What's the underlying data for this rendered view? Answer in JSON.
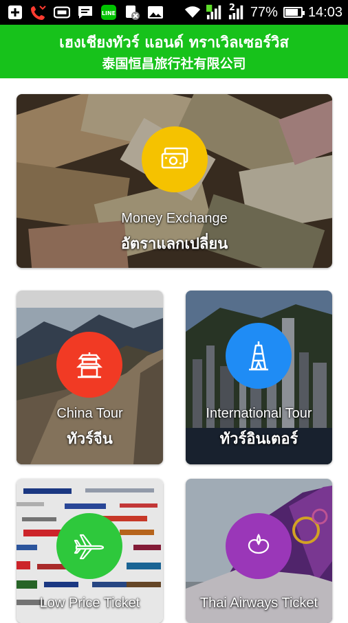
{
  "status_bar": {
    "battery_percent": "77%",
    "time": "14:03",
    "sim2_label": "2",
    "icons": [
      "plus-icon",
      "missed-call-icon",
      "tablet-icon",
      "message-icon",
      "line-app-icon",
      "app-notification-icon",
      "image-icon",
      "wifi-icon",
      "signal-icon"
    ]
  },
  "header": {
    "title_thai": "เฮงเชียงทัวร์ แอนด์ ทราเวิลเซอร์วิส",
    "title_chinese": "泰国恒昌旅行社有限公司",
    "color": "#17c21b"
  },
  "tiles": [
    {
      "id": "money",
      "en": "Money Exchange",
      "th": "อัตราแลกเปลี่ยน",
      "icon": "money-bills-icon",
      "circle_color": "#f5c200"
    },
    {
      "id": "china",
      "en": "China Tour",
      "th": "ทัวร์จีน",
      "icon": "pagoda-icon",
      "circle_color": "#f13a24"
    },
    {
      "id": "intl",
      "en": "International Tour",
      "th": "ทัวร์อินเตอร์",
      "icon": "eiffel-tower-icon",
      "circle_color": "#1f8cf5"
    },
    {
      "id": "low",
      "en": "Low Price Ticket",
      "th": "",
      "icon": "airplane-icon",
      "circle_color": "#2ec83c"
    },
    {
      "id": "thai",
      "en": "Thai Airways Ticket",
      "th": "",
      "icon": "thai-airways-logo-icon",
      "circle_color": "#9a37b8"
    }
  ]
}
